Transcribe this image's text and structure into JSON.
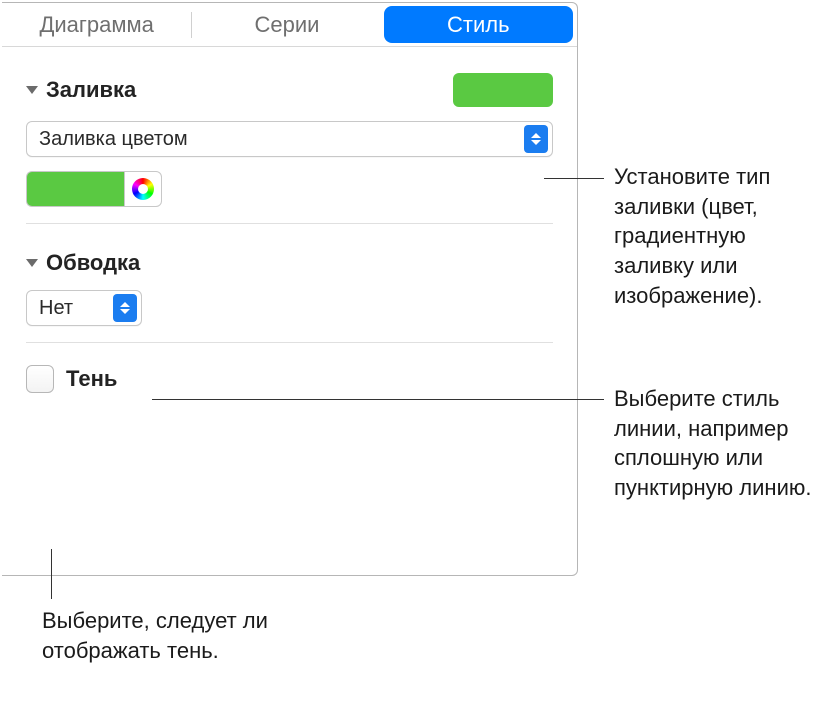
{
  "tabs": {
    "diagram": "Диаграмма",
    "series": "Серии",
    "style": "Стиль"
  },
  "fill": {
    "title": "Заливка",
    "type_selected": "Заливка цветом",
    "swatch_color": "#5ac942"
  },
  "stroke": {
    "title": "Обводка",
    "style_selected": "Нет"
  },
  "shadow": {
    "label": "Тень"
  },
  "callouts": {
    "fill": "Установите тип заливки (цвет, градиентную заливку или изображение).",
    "stroke": "Выберите стиль линии, например сплошную или пунктирную линию.",
    "shadow": "Выберите, следует ли отображать тень."
  }
}
